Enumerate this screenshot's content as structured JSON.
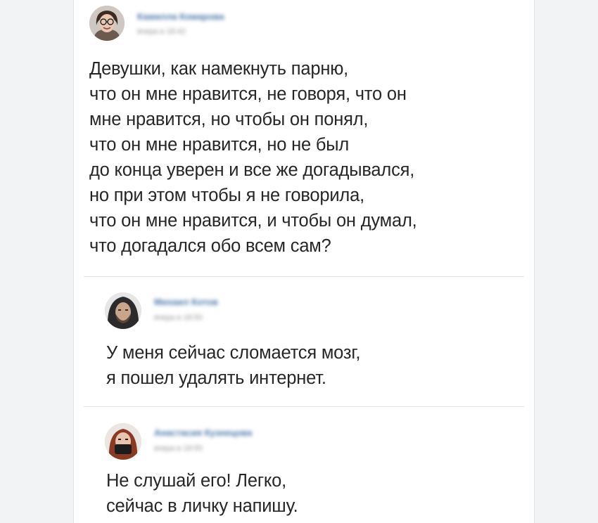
{
  "post": {
    "author": "Камилла Комарова",
    "date": "вчера в 18:42",
    "text": "Девушки, как намекнуть парню,\nчто он мне нравится, не говоря, что он\nмне нравится, но чтобы он понял,\nчто он мне нравится, но не был\nдо конца уверен и все же догадывался,\nно при этом чтобы я не говорила,\nчто он мне нравится, и чтобы он думал,\nчто догадался обо всем сам?"
  },
  "comments": [
    {
      "author": "Михаил Котов",
      "date": "вчера в 18:50",
      "text": "У меня сейчас сломается мозг,\nя пошел удалять интернет."
    },
    {
      "author": "Анастасия Кузнецова",
      "date": "вчера в 18:55",
      "text": "Не слушай его! Легко,\nсейчас в личку напишу."
    }
  ]
}
